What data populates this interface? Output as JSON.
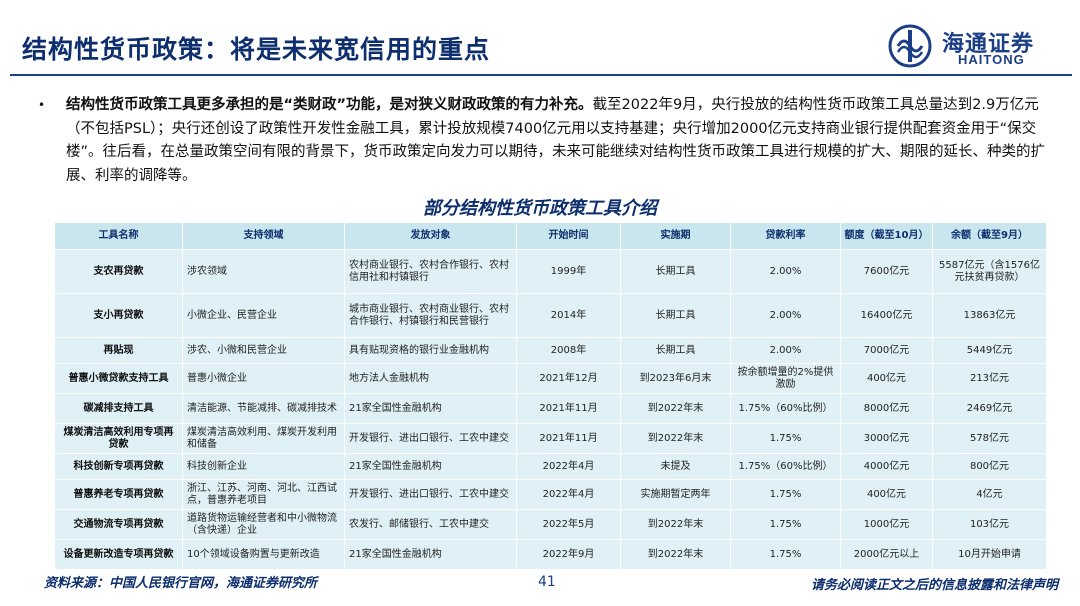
{
  "header": {
    "title": "结构性货币政策：将是未来宽信用的重点",
    "logo_cn": "海通证券",
    "logo_en": "HAITONG"
  },
  "paragraph": {
    "bullet": "•",
    "bold": "结构性货币政策工具更多承担的是“类财政”功能，是对狭义财政政策的有力补充。",
    "rest": "截至2022年9月，央行投放的结构性货币政策工具总量达到2.9万亿元（不包括PSL）；央行还创设了政策性开发性金融工具，累计投放规模7400亿元用以支持基建；央行增加2000亿元支持商业银行提供配套资金用于“保交楼”。往后看，在总量政策空间有限的背景下，货币政策定向发力可以期待，未来可能继续对结构性货币政策工具进行规模的扩大、期限的延长、种类的扩展、利率的调降等。"
  },
  "table": {
    "title": "部分结构性货币政策工具介绍",
    "headers": [
      "工具名称",
      "支持领域",
      "发放对象",
      "开始时间",
      "实施期",
      "贷款利率",
      "额度（截至10月）",
      "余额（截至9月）"
    ],
    "rows": [
      [
        "支农再贷款",
        "涉农领域",
        "农村商业银行、农村合作银行、农村信用社和村镇银行",
        "1999年",
        "长期工具",
        "2.00%",
        "7600亿元",
        "5587亿元（含1576亿元扶贫再贷款）"
      ],
      [
        "支小再贷款",
        "小微企业、民营企业",
        "城市商业银行、农村商业银行、农村合作银行、村镇银行和民营银行",
        "2014年",
        "长期工具",
        "2.00%",
        "16400亿元",
        "13863亿元"
      ],
      [
        "再贴现",
        "涉农、小微和民营企业",
        "具有贴现资格的银行业金融机构",
        "2008年",
        "长期工具",
        "2.00%",
        "7000亿元",
        "5449亿元"
      ],
      [
        "普惠小微贷款支持工具",
        "普惠小微企业",
        "地方法人金融机构",
        "2021年12月",
        "到2023年6月末",
        "按余额增量的2%提供激励",
        "400亿元",
        "213亿元"
      ],
      [
        "碳减排支持工具",
        "清洁能源、节能减排、碳减排技术",
        "21家全国性金融机构",
        "2021年11月",
        "到2022年末",
        "1.75%（60%比例）",
        "8000亿元",
        "2469亿元"
      ],
      [
        "煤炭清洁高效利用专项再贷款",
        "煤炭清洁高效利用、煤炭开发利用和储备",
        "开发银行、进出口银行、工农中建交",
        "2021年11月",
        "到2022年末",
        "1.75%",
        "3000亿元",
        "578亿元"
      ],
      [
        "科技创新专项再贷款",
        "科技创新企业",
        "21家全国性金融机构",
        "2022年4月",
        "未提及",
        "1.75%（60%比例）",
        "4000亿元",
        "800亿元"
      ],
      [
        "普惠养老专项再贷款",
        "浙江、江苏、河南、河北、江西试点，普惠养老项目",
        "开发银行、进出口银行、工农中建交",
        "2022年4月",
        "实施期暂定两年",
        "1.75%",
        "400亿元",
        "4亿元"
      ],
      [
        "交通物流专项再贷款",
        "道路货物运输经营者和中小微物流（含快递）企业",
        "农发行、邮储银行、工农中建交",
        "2022年5月",
        "到2022年末",
        "1.75%",
        "1000亿元",
        "103亿元"
      ],
      [
        "设备更新改造专项再贷款",
        "10个领域设备购置与更新改造",
        "21家全国性金融机构",
        "2022年9月",
        "到2022年末",
        "1.75%",
        "2000亿元以上",
        "10月开始申请"
      ]
    ]
  },
  "footer": {
    "source": "资料来源：中国人民银行官网，海通证券研究所",
    "page": "41",
    "disclaimer": "请务必阅读正文之后的信息披露和法律声明"
  }
}
